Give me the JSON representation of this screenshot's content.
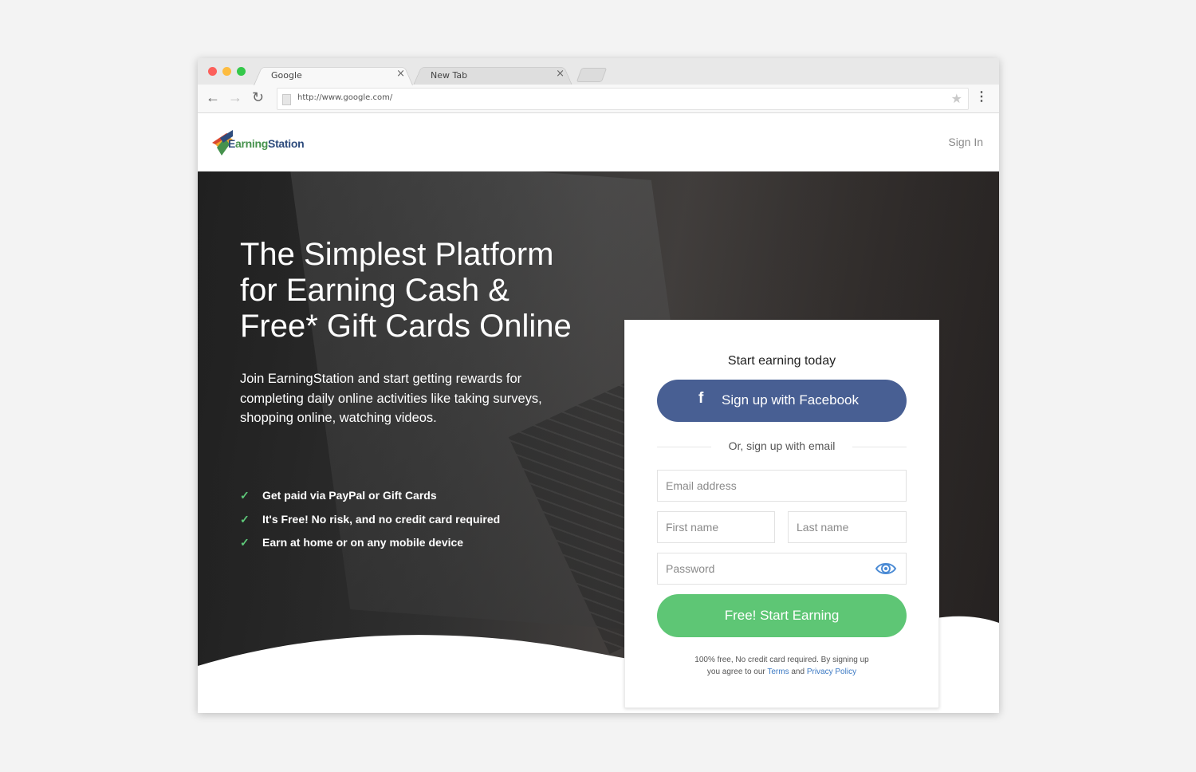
{
  "browser": {
    "tabs": [
      {
        "label": "Google",
        "close": "×"
      },
      {
        "label": "New Tab",
        "close": "×"
      }
    ],
    "nav": {
      "back": "←",
      "forward": "→",
      "reload": "↻"
    },
    "url": "http://www.google.com/",
    "star": "★",
    "menu": "⋮"
  },
  "site": {
    "logo_text_e": "E",
    "logo_text_rest": "arning",
    "logo_text_station": "Station",
    "signin_label": "Sign In"
  },
  "hero": {
    "headline_lines": [
      "The Simplest Platform",
      "for Earning Cash &",
      "Free* Gift Cards Online"
    ],
    "subtext": "Join EarningStation and start getting rewards for completing daily online activities like taking surveys, shopping online, watching videos.",
    "benefits": [
      "Get paid via PayPal or Gift Cards",
      "It's Free! No risk, and no credit card required",
      "Earn at home or on any mobile device"
    ],
    "check_glyph": "✓"
  },
  "signup": {
    "title": "Start earning today",
    "facebook_icon": "f",
    "facebook_label": "Sign up with Facebook",
    "divider_text": "Or, sign up with email",
    "email_placeholder": "Email address",
    "first_placeholder": "First name",
    "last_placeholder": "Last name",
    "password_placeholder": "Password",
    "cta_label": "Free! Start Earning",
    "fine_line1": "100% free, No credit card required. By signing up",
    "fine_prefix": "you agree to our ",
    "terms_label": "Terms",
    "and_text": " and ",
    "privacy_label": "Privacy Policy"
  },
  "colors": {
    "facebook": "#485f93",
    "cta": "#5ec675",
    "check": "#5ec97a",
    "link": "#3a78c3",
    "eye": "#4a8ad4"
  }
}
